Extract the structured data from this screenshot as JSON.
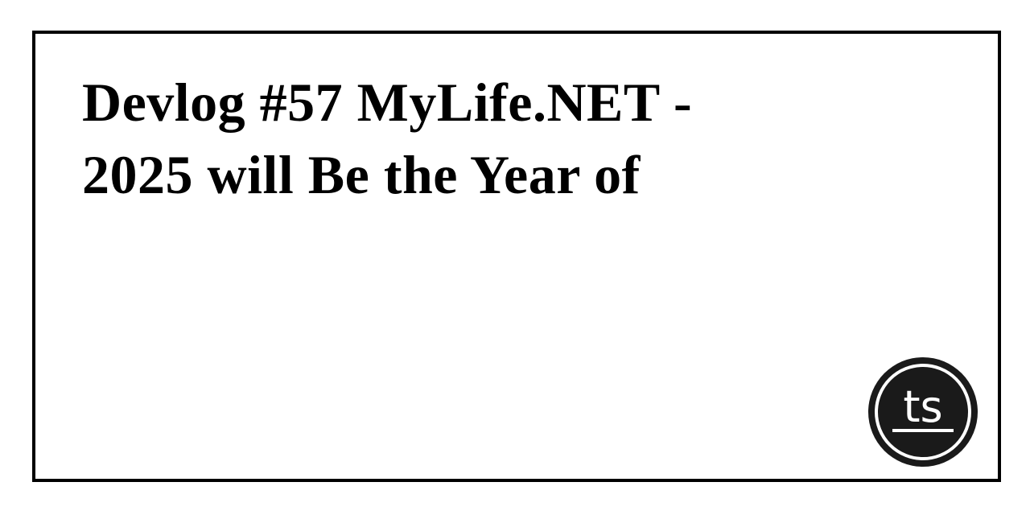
{
  "card": {
    "title_line1": "Devlog #57 MyLife.NET -",
    "title_line2": "2025 will Be the Year of"
  },
  "logo": {
    "text": "ts",
    "icon": "ts-logo-icon",
    "colors": {
      "background": "#1a1a1a",
      "ring": "#ffffff",
      "text": "#ffffff"
    }
  }
}
